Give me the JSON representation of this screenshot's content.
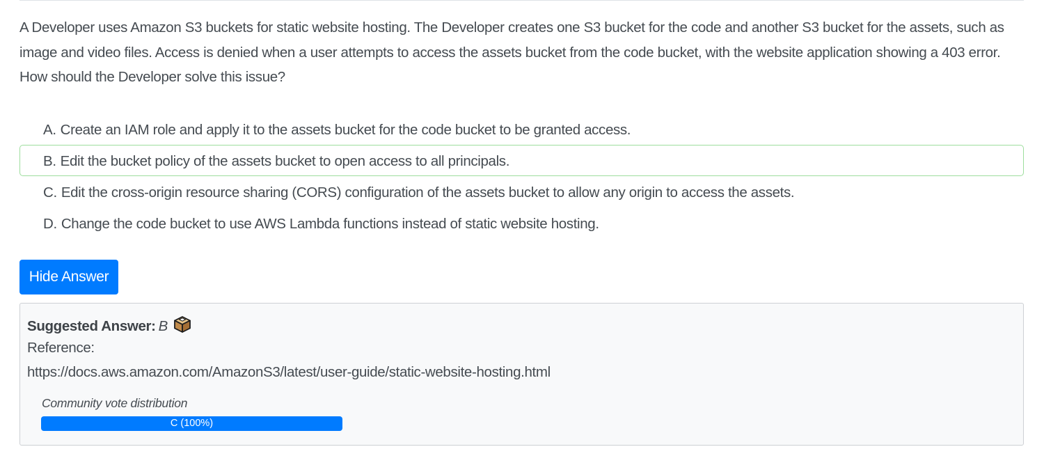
{
  "question": {
    "paragraph1": "A Developer uses Amazon S3 buckets for static website hosting. The Developer creates one S3 bucket for the code and another S3 bucket for the assets, such as image and video files. Access is denied when a user attempts to access the assets bucket from the code bucket, with the website application showing a 403 error.",
    "paragraph2": "How should the Developer solve this issue?"
  },
  "choices": [
    {
      "letter": "A.",
      "text": "Create an IAM role and apply it to the assets bucket for the code bucket to be granted access."
    },
    {
      "letter": "B.",
      "text": "Edit the bucket policy of the assets bucket to open access to all principals."
    },
    {
      "letter": "C.",
      "text": "Edit the cross-origin resource sharing (CORS) configuration of the assets bucket to allow any origin to access the assets."
    },
    {
      "letter": "D.",
      "text": "Change the code bucket to use AWS Lambda functions instead of static website hosting."
    }
  ],
  "hide_answer_label": "Hide Answer",
  "answer": {
    "label": "Suggested Answer:",
    "value": "B",
    "icon": "ballot-box-icon",
    "reference_label": "Reference:",
    "reference_url": "https://docs.aws.amazon.com/AmazonS3/latest/user-guide/static-website-hosting.html"
  },
  "vote": {
    "title": "Community vote distribution",
    "bar_label": "C (100%)",
    "percent": 100
  },
  "colors": {
    "primary": "#007bff",
    "highlight_border": "#9ddd9d",
    "answer_bg": "#f8f9fa",
    "text": "#454b51"
  }
}
